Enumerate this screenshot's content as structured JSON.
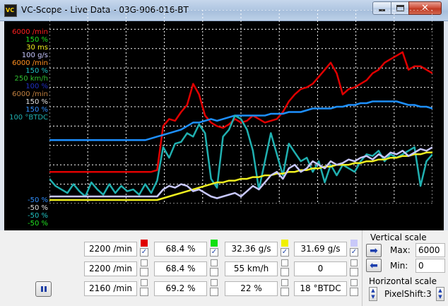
{
  "window": {
    "title": "VC-Scope  -  Live Data  -  03G-906-016-BT"
  },
  "axis_labels": {
    "top": [
      {
        "text": "6000 /min",
        "color": "#ff2020"
      },
      {
        "text": "150 %",
        "color": "#20e020"
      },
      {
        "text": "30 ms",
        "color": "#f0f020"
      },
      {
        "text": "100 g/s",
        "color": "#c8c8ff"
      },
      {
        "text": "6000 /min",
        "color": "#ff9020"
      },
      {
        "text": "150 %",
        "color": "#20c0c0"
      },
      {
        "text": "250 km/h",
        "color": "#30c030"
      },
      {
        "text": "100 %",
        "color": "#2030c0"
      },
      {
        "text": "6000 /min",
        "color": "#c08040"
      },
      {
        "text": "150 %",
        "color": "#e0e0e0"
      },
      {
        "text": "150 %",
        "color": "#3090ff"
      },
      {
        "text": "100 °BTDC",
        "color": "#20b0b0"
      }
    ],
    "bottom": [
      {
        "text": "-50 %",
        "color": "#3090ff"
      },
      {
        "text": "-50 %",
        "color": "#e0e0e0"
      },
      {
        "text": "-50 %",
        "color": "#20c0c0"
      },
      {
        "text": "-50 %",
        "color": "#20e020"
      }
    ]
  },
  "chart_data": {
    "type": "line",
    "grid": true,
    "x": [
      0,
      4,
      8,
      12,
      16,
      20,
      24,
      28,
      32,
      36,
      40,
      44,
      48,
      52,
      56,
      60,
      64,
      68,
      72,
      76,
      80,
      84,
      88,
      92,
      96,
      100
    ],
    "series": [
      {
        "color": "#e00000",
        "values": [
          8,
          8,
          8,
          8,
          8,
          8,
          8,
          8,
          8,
          8,
          8,
          8,
          8,
          8,
          8,
          8,
          8,
          8,
          9,
          34,
          38,
          37,
          42,
          46,
          58,
          52,
          40,
          36,
          34,
          33,
          35,
          38,
          36,
          37,
          40,
          38,
          36,
          37,
          38,
          42,
          48,
          52,
          55,
          56,
          58,
          62,
          66,
          70,
          64,
          52,
          55,
          56,
          58,
          60,
          64,
          66,
          70,
          72,
          74,
          76,
          66,
          68,
          68,
          66,
          64
        ]
      },
      {
        "color": "#1e90ff",
        "values": [
          26,
          26,
          26,
          26,
          26,
          26,
          26,
          26,
          26,
          26,
          26,
          26,
          26,
          26,
          26,
          26,
          26,
          27,
          28,
          29,
          30,
          31,
          32,
          34,
          36,
          36,
          37,
          38,
          37,
          38,
          39,
          40,
          40,
          40,
          40,
          40,
          40,
          41,
          41,
          41,
          42,
          42,
          42,
          43,
          44,
          44,
          44,
          44,
          45,
          45,
          46,
          46,
          47,
          47,
          48,
          48,
          48,
          48,
          48,
          47,
          46,
          46,
          45,
          45,
          44
        ]
      },
      {
        "color": "#20b0b0",
        "values": [
          4,
          0,
          -2,
          -4,
          1,
          -3,
          -6,
          2,
          -2,
          -5,
          1,
          -4,
          0,
          -3,
          -2,
          -5,
          1,
          -4,
          3,
          22,
          16,
          24,
          25,
          30,
          28,
          35,
          30,
          4,
          -1,
          28,
          32,
          40,
          38,
          32,
          20,
          -2,
          14,
          30,
          18,
          6,
          24,
          19,
          14,
          16,
          8,
          14,
          2,
          12,
          6,
          12,
          10,
          8,
          14,
          18,
          17,
          20,
          14,
          18,
          16,
          18,
          20,
          22,
          0,
          14,
          18
        ]
      },
      {
        "color": "#f0f020",
        "values": [
          -8,
          -8,
          -8,
          -8,
          -8,
          -8,
          -8,
          -8,
          -8,
          -8,
          -8,
          -8,
          -8,
          -8,
          -8,
          -8,
          -8,
          -8,
          -8,
          -7,
          -6,
          -5,
          -4,
          -3,
          -2,
          -1,
          0,
          1,
          2,
          2,
          3,
          3,
          4,
          4,
          5,
          5,
          6,
          6,
          7,
          7,
          8,
          8,
          9,
          9,
          10,
          10,
          11,
          11,
          12,
          12,
          12,
          13,
          13,
          14,
          14,
          15,
          15,
          16,
          16,
          17,
          17,
          18,
          18,
          19,
          19
        ]
      },
      {
        "color": "#c8c8ff",
        "values": [
          -6,
          -6,
          -6,
          -6,
          -6,
          -6,
          -6,
          -6,
          -6,
          -6,
          -6,
          -6,
          -6,
          -6,
          -6,
          -6,
          -6,
          -6,
          -6,
          -2,
          0,
          -1,
          1,
          0,
          -3,
          -2,
          -4,
          -6,
          -7,
          -6,
          -5,
          -4,
          -6,
          -3,
          0,
          -2,
          2,
          6,
          8,
          4,
          10,
          12,
          8,
          10,
          14,
          12,
          10,
          14,
          12,
          13,
          15,
          14,
          16,
          17,
          15,
          18,
          16,
          19,
          18,
          20,
          17,
          19,
          21,
          20,
          22
        ]
      }
    ],
    "ylim": [
      -10,
      100
    ]
  },
  "channels": [
    {
      "value": "2200 /min",
      "swatch": "#e00000",
      "checked": true
    },
    {
      "value": "68.4 %",
      "swatch": "#10e010",
      "checked": true
    },
    {
      "value": "32.36 g/s",
      "swatch": "#f0f000",
      "checked": true
    },
    {
      "value": "31.69 g/s",
      "swatch": "#c8c8f8",
      "checked": true
    },
    {
      "value": "2200 /min",
      "swatch": "",
      "checked": false
    },
    {
      "value": "68.4 %",
      "swatch": "",
      "checked": false
    },
    {
      "value": "55 km/h",
      "swatch": "",
      "checked": false
    },
    {
      "value": "0",
      "swatch": "",
      "checked": false
    },
    {
      "value": "2160 /min",
      "swatch": "",
      "checked": false
    },
    {
      "value": "69.2 %",
      "swatch": "",
      "checked": false
    },
    {
      "value": "22 %",
      "swatch": "",
      "checked": false
    },
    {
      "value": "18 °BTDC",
      "swatch": "",
      "checked": false
    }
  ],
  "vertical_scale": {
    "label": "Vertical scale",
    "max_label": "Max:",
    "max_value": "6000",
    "min_label": "Min:",
    "min_value": "0"
  },
  "horizontal_scale": {
    "label": "Horizontal scale",
    "value": "PixelShift:3"
  }
}
